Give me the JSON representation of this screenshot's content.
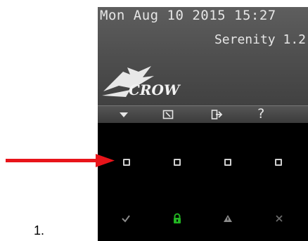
{
  "status": {
    "datetime": "Mon Aug 10 2015 15:27",
    "version": "Serenity 1.2"
  },
  "logo": {
    "text": "CROW"
  },
  "toolbar": {
    "icons": [
      "chevron-down-icon",
      "edit-icon",
      "exit-icon",
      "help-icon"
    ],
    "help_label": "?"
  },
  "keys": {
    "count": 4,
    "icon": "square-key-icon"
  },
  "actions": {
    "icons": [
      "check-icon",
      "lock-icon",
      "warning-icon",
      "close-icon"
    ],
    "colors": {
      "check": "#8a8a8a",
      "lock": "#22b522",
      "warning": "#8a8a8a",
      "close": "#6a6a6a"
    }
  },
  "annotation": {
    "arrow_color": "#e8141a",
    "figure_label": "1."
  }
}
